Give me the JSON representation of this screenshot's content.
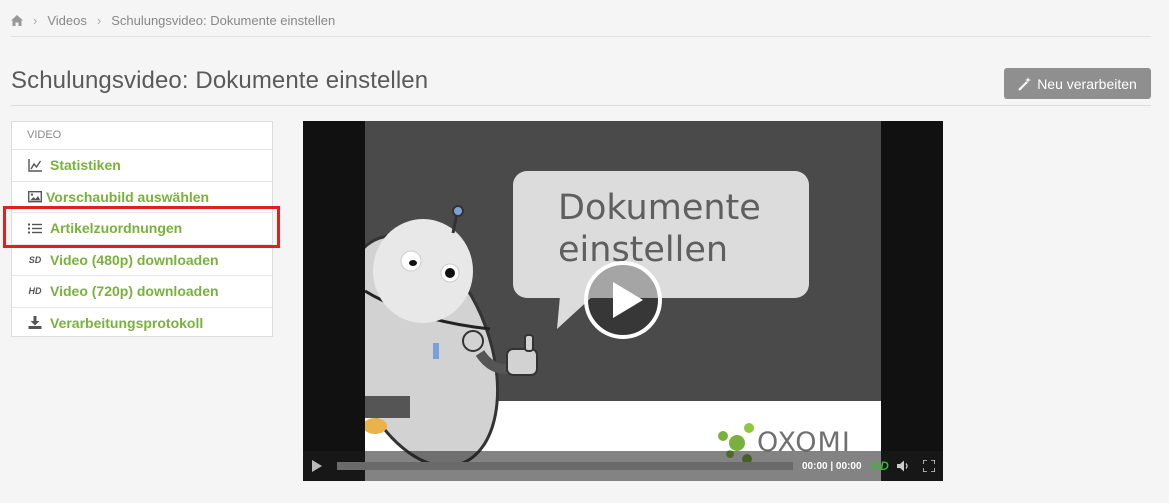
{
  "breadcrumb": {
    "home_icon": "home-icon",
    "items": [
      "Videos",
      "Schulungsvideo: Dokumente einstellen"
    ]
  },
  "page": {
    "title": "Schulungsvideo: Dokumente einstellen",
    "reprocess_label": "Neu verarbeiten",
    "reprocess_icon": "magic-wand-icon"
  },
  "sidebar": {
    "header": "VIDEO",
    "items": [
      {
        "label": "Statistiken",
        "icon": "line-chart-icon"
      },
      {
        "label": "Vorschaubild auswählen",
        "icon": "image-icon"
      },
      {
        "label": "Artikelzuordnungen",
        "icon": "list-icon"
      },
      {
        "label": "Video (480p) downloaden",
        "icon": "sd-icon",
        "badge": "SD"
      },
      {
        "label": "Video (720p) downloaden",
        "icon": "hd-icon",
        "badge": "HD"
      },
      {
        "label": "Verarbeitungsprotokoll",
        "icon": "download-icon"
      }
    ],
    "highlighted_index": 2,
    "link_color": "#7ab13c"
  },
  "video": {
    "poster_title_line1": "Dokumente",
    "poster_title_line2": "einstellen",
    "brand": "OXOMI",
    "time": "00:00 | 00:00",
    "hd_label": "HD",
    "progress": 0
  },
  "colors": {
    "accent_green": "#7ab13c",
    "highlight_red": "#e02020",
    "button_gray": "#8f8f8f"
  }
}
